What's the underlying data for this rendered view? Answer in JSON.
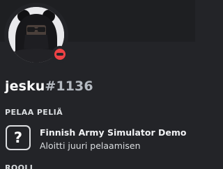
{
  "profile": {
    "username": "jesku",
    "discriminator": "#1136",
    "status": "dnd",
    "status_color": "#ed4245",
    "avatar_icon": "user-avatar"
  },
  "activity": {
    "section_title": "PELAA PELIÄ",
    "game_name": "Finnish Army Simulator Demo",
    "game_state": "Aloitti juuri pelaamisen",
    "game_icon": "unknown-game-icon",
    "icon_glyph": "?"
  },
  "roles": {
    "section_title": "ROOLI"
  },
  "colors": {
    "background": "#232428",
    "banner": "#1e1f22",
    "username": "#ffffff",
    "discriminator": "#b5bac1"
  }
}
